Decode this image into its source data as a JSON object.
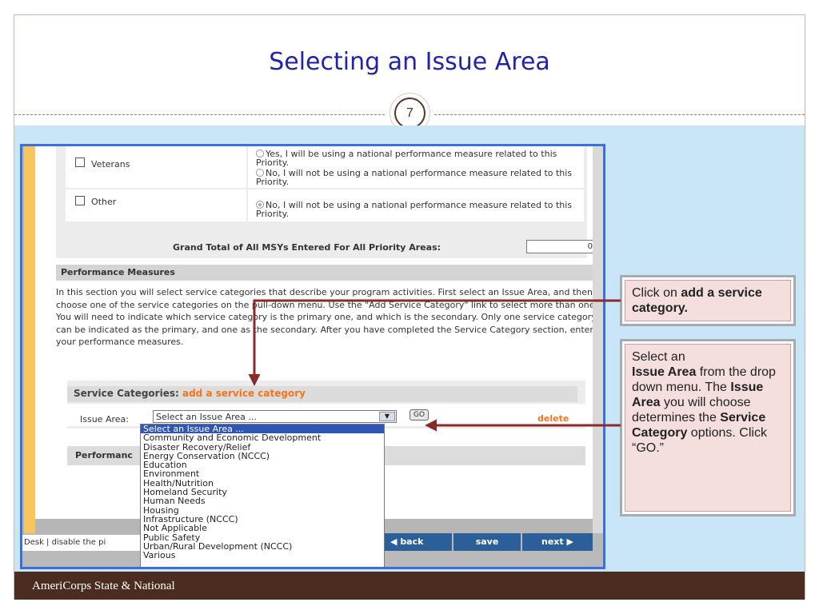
{
  "slide": {
    "title": "Selecting an Issue Area",
    "number": "7",
    "footer": "AmeriCorps State & National"
  },
  "screen": {
    "priorities": [
      {
        "label": "Veterans",
        "options": [
          "Yes, I will be using a national performance measure related to this Priority.",
          "No, I will not be using a national performance measure related to this Priority."
        ]
      },
      {
        "label": "Other",
        "options": [
          "No, I will not be using a national performance measure related to this Priority."
        ]
      }
    ],
    "grand_total_label": "Grand Total of All MSYs Entered For All Priority Areas:",
    "grand_total_value": "0",
    "performance_measures_header": "Performance Measures",
    "performance_measures_text": "In this section you will select service categories that describe your program activities. First select an Issue Area, and then choose one of the service categories on the pull-down menu. Use the \"Add Service Category\" link to select more than one. You will need to indicate which service category is the primary one, and which is the secondary. Only one service category can be indicated as the primary, and one as the secondary. After you have completed the Service Category section, enter your performance measures.",
    "service_categories_label": "Service Categories:",
    "add_service_category_link": "add a service category",
    "issue_area_label": "Issue Area:",
    "issue_area_selected": "Select an Issue Area ...",
    "go_button": "GO",
    "delete_link": "delete",
    "performance_row_label": "Performanc",
    "issue_area_options": [
      "Select an Issue Area ...",
      "Community and Economic Development",
      "Disaster Recovery/Relief",
      "Energy Conservation (NCCC)",
      "Education",
      "Environment",
      "Health/Nutrition",
      "Homeland Security",
      "Human Needs",
      "Housing",
      "Infrastructure (NCCC)",
      "Not Applicable",
      "Public Safety",
      "Urban/Rural Development (NCCC)",
      "Various"
    ],
    "footer_left_text": "Desk  |  disable the pi",
    "nav": {
      "back": "back",
      "save": "save",
      "next": "next"
    }
  },
  "callouts": {
    "first": {
      "pre": "Click on ",
      "bold": "add a service category."
    },
    "second": {
      "line1": "Select an",
      "bold1": "Issue Area",
      "text1": " from the drop down menu. The ",
      "bold2": "Issue Area",
      "text2": " you will choose  determines the ",
      "bold3": "Service Category",
      "text3": " options. Click “GO.”"
    }
  },
  "colors": {
    "title": "#2323a8",
    "footer_bg": "#4a2c20",
    "content_bg": "#c8e6f8",
    "screenshot_border": "#3a6fe0",
    "link_orange": "#f2751b",
    "arrow": "#8b2a2a",
    "callout_bg": "#f4dede"
  }
}
